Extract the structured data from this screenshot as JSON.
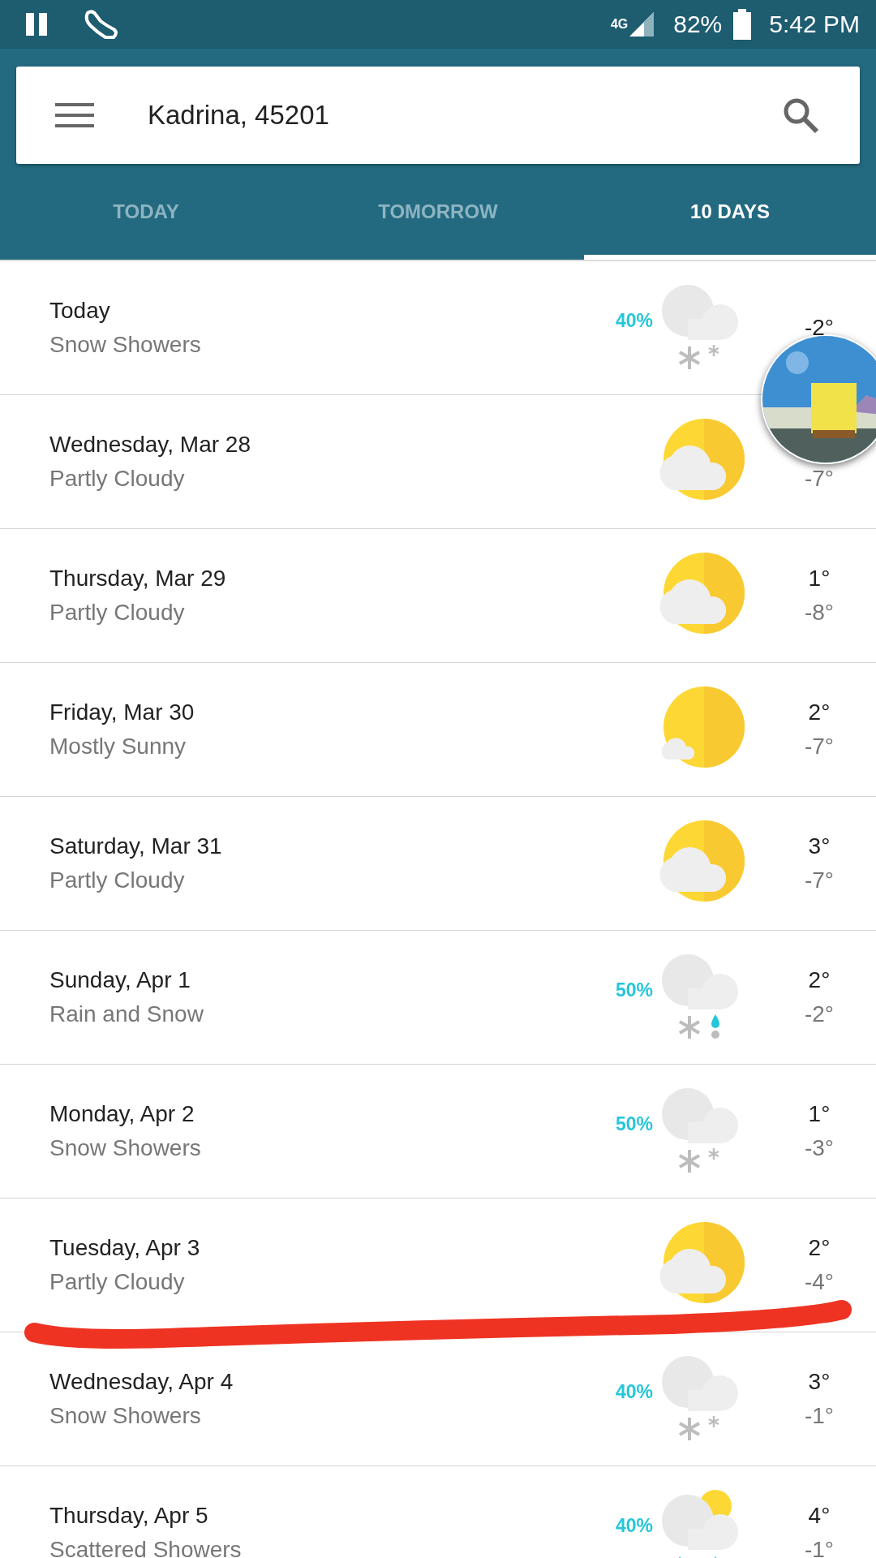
{
  "status_bar": {
    "network": "4G",
    "battery": "82%",
    "time": "5:42 PM"
  },
  "search": {
    "value": "Kadrina, 45201"
  },
  "tabs": [
    {
      "label": "TODAY",
      "selected": false
    },
    {
      "label": "TOMORROW",
      "selected": false
    },
    {
      "label": "10 DAYS",
      "selected": true
    }
  ],
  "days": [
    {
      "day": "Today",
      "condition": "Snow Showers",
      "kind": "snow",
      "precip": "40%",
      "high": "-2°"
    },
    {
      "day": "Wednesday, Mar 28",
      "condition": "Partly Cloudy",
      "kind": "partly-cloudy",
      "low": "-7°"
    },
    {
      "day": "Thursday, Mar 29",
      "condition": "Partly Cloudy",
      "kind": "partly-cloudy",
      "high": "1°",
      "low": "-8°"
    },
    {
      "day": "Friday, Mar 30",
      "condition": "Mostly Sunny",
      "kind": "mostly-sunny",
      "high": "2°",
      "low": "-7°"
    },
    {
      "day": "Saturday, Mar 31",
      "condition": "Partly Cloudy",
      "kind": "partly-cloudy",
      "high": "3°",
      "low": "-7°"
    },
    {
      "day": "Sunday, Apr 1",
      "condition": "Rain and Snow",
      "kind": "rain-snow",
      "precip": "50%",
      "high": "2°",
      "low": "-2°"
    },
    {
      "day": "Monday, Apr 2",
      "condition": "Snow Showers",
      "kind": "snow",
      "precip": "50%",
      "high": "1°",
      "low": "-3°"
    },
    {
      "day": "Tuesday, Apr 3",
      "condition": "Partly Cloudy",
      "kind": "partly-cloudy",
      "high": "2°",
      "low": "-4°"
    },
    {
      "day": "Wednesday, Apr 4",
      "condition": "Snow Showers",
      "kind": "snow",
      "precip": "40%",
      "high": "3°",
      "low": "-1°"
    },
    {
      "day": "Thursday, Apr 5",
      "condition": "Scattered Showers",
      "kind": "scattered-showers",
      "precip": "40%",
      "high": "4°",
      "low": "-1°"
    }
  ]
}
